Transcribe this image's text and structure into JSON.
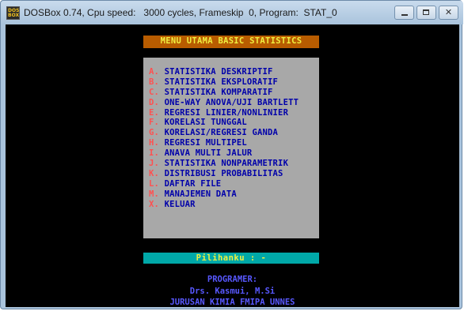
{
  "window": {
    "title": "DOSBox 0.74, Cpu speed:   3000 cycles, Frameskip  0, Program:  STAT_0",
    "controls": {
      "minimize": "minimize",
      "maximize": "maximize",
      "close": "✕"
    }
  },
  "app_icon": {
    "line1": "DOS",
    "line2": "BOX"
  },
  "menu": {
    "header": "MENU UTAMA BASIC STATISTICS",
    "items": [
      {
        "key": "A.",
        "label": "STATISTIKA DESKRIPTIF"
      },
      {
        "key": "B.",
        "label": "STATISTIKA EKSPLORATIF"
      },
      {
        "key": "C.",
        "label": "STATISTIKA KOMPARATIF"
      },
      {
        "key": "D.",
        "label": "ONE-WAY ANOVA/UJI BARTLETT"
      },
      {
        "key": "E.",
        "label": "REGRESI LINIER/NONLINIER"
      },
      {
        "key": "F.",
        "label": "KORELASI TUNGGAL"
      },
      {
        "key": "G.",
        "label": "KORELASI/REGRESI GANDA"
      },
      {
        "key": "H.",
        "label": "REGRESI MULTIPEL"
      },
      {
        "key": "I.",
        "label": "ANAVA MULTI JALUR"
      },
      {
        "key": "J.",
        "label": "STATISTIKA NONPARAMETRIK"
      },
      {
        "key": "K.",
        "label": "DISTRIBUSI PROBABILITAS"
      },
      {
        "key": "L.",
        "label": "DAFTAR FILE"
      },
      {
        "key": "M.",
        "label": "MANAJEMEN DATA"
      },
      {
        "key": "X.",
        "label": "KELUAR"
      }
    ],
    "prompt": "Pilihanku : -"
  },
  "credits": {
    "line1": "PROGRAMER:",
    "line2": "Drs. Kasmui, M.Si",
    "line3": "JURUSAN KIMIA FMIPA UNNES"
  },
  "colors": {
    "screen_bg": "#000000",
    "header_bg": "#b85c00",
    "header_text": "#f0f040",
    "menu_bg": "#a8a8a8",
    "menu_key": "#ff5050",
    "menu_text": "#0000aa",
    "prompt_bg": "#00a8a8",
    "credit_text": "#5858ff"
  }
}
